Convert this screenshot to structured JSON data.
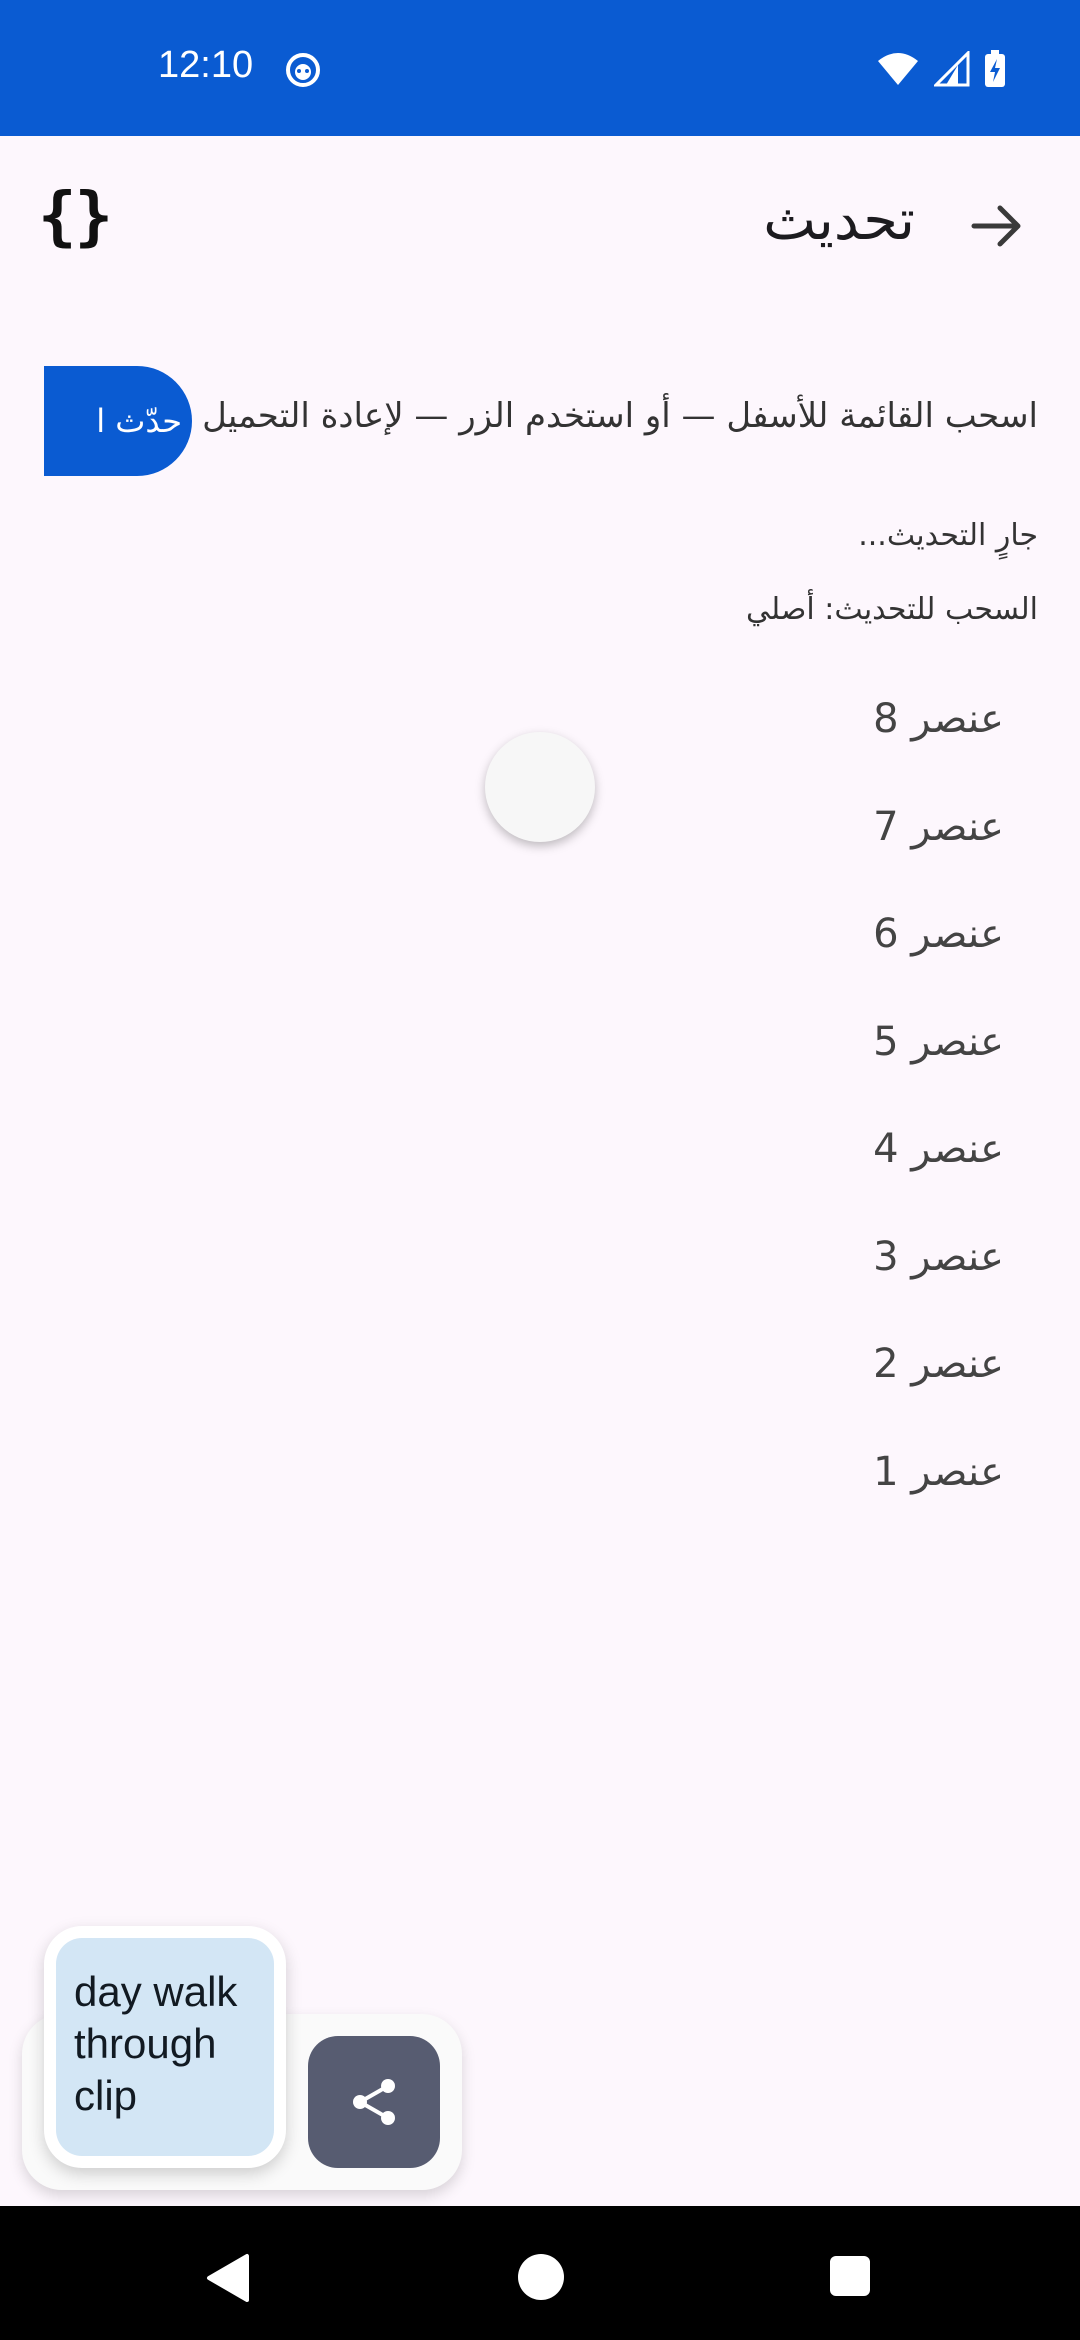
{
  "status_bar": {
    "time": "12:10",
    "notification_icon": "smiley-icon",
    "icons": [
      "wifi-icon",
      "signal-icon",
      "battery-charging-icon"
    ],
    "background_color": "#0a5bd2"
  },
  "toolbar": {
    "title": "تحديث",
    "back_icon": "arrow-right-icon",
    "action_icon": "code-braces-icon",
    "braces_glyph": "{}"
  },
  "content": {
    "instruction": "اسحب القائمة للأسفل — أو استخدم الزر — لإعادة التحميل",
    "refresh_button_label": "حدّث ا",
    "status_refreshing": "جارٍ التحديث...",
    "status_pull": "السحب للتحديث: أصلي",
    "items": [
      "عنصر 8",
      "عنصر 7",
      "عنصر 6",
      "عنصر 5",
      "عنصر 4",
      "عنصر 3",
      "عنصر 2",
      "عنصر 1"
    ]
  },
  "floating": {
    "clip_label": "day walk through clip",
    "share_icon": "share-icon"
  },
  "nav_bar": {
    "icons": [
      "back-triangle-icon",
      "home-circle-icon",
      "recents-square-icon"
    ]
  }
}
